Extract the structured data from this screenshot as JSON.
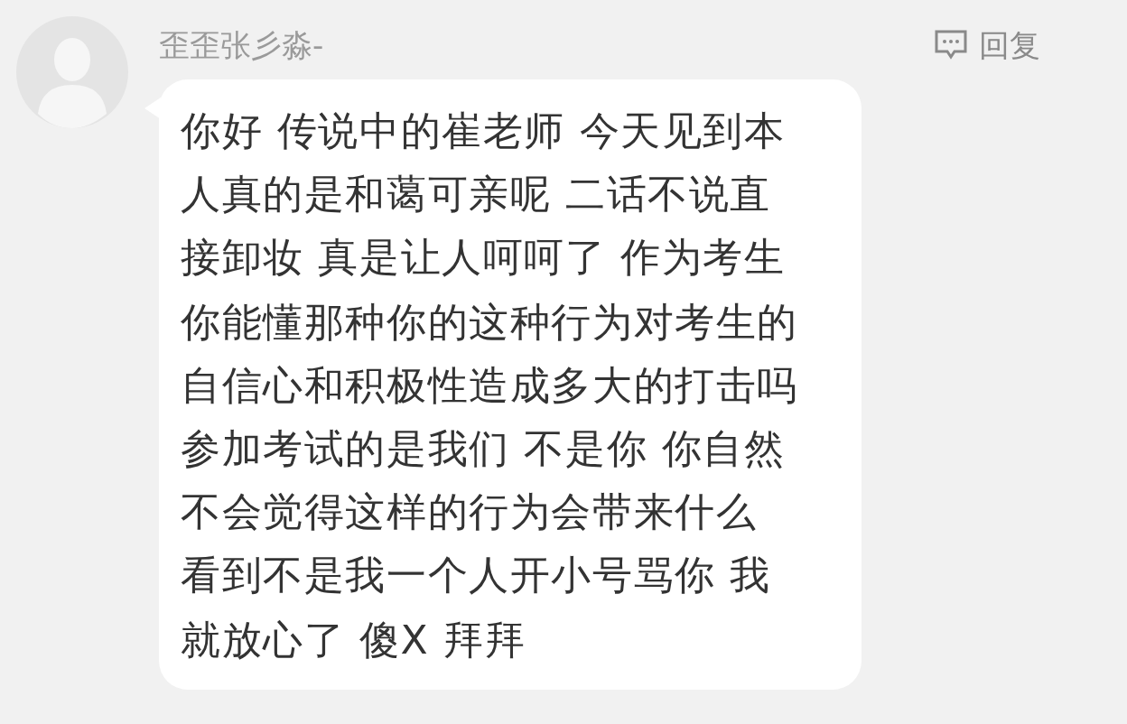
{
  "comment": {
    "author": "歪歪张彡淼-",
    "reply_label": "回复",
    "message_lines": [
      "你好 传说中的崔老师 今天见到本",
      "人真的是和蔼可亲呢 二话不说直",
      "接卸妆 真是让人呵呵了 作为考生",
      "你能懂那种你的这种行为对考生的",
      "自信心和积极性造成多大的打击吗",
      "参加考试的是我们 不是你 你自然",
      "不会觉得这样的行为会带来什么",
      "看到不是我一个人开小号骂你 我",
      "就放心了 傻X 拜拜"
    ]
  }
}
